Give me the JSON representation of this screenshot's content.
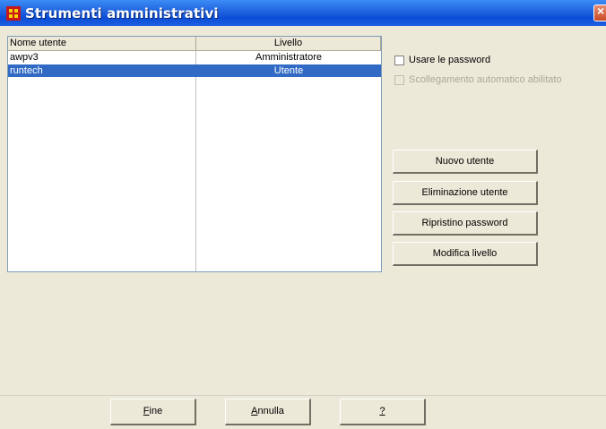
{
  "window": {
    "title": "Strumenti amministrativi",
    "icon": "app-flag-icon",
    "close_symbol": "×"
  },
  "users_table": {
    "columns": [
      "Nome utente",
      "Livello"
    ],
    "rows": [
      {
        "name": "awpv3",
        "level": "Amministratore",
        "selected": false
      },
      {
        "name": "runtech",
        "level": "Utente",
        "selected": true
      }
    ]
  },
  "options": {
    "use_passwords": {
      "label": "Usare le password",
      "checked": false,
      "enabled": true
    },
    "auto_logout": {
      "label": "Scollegamento automatico abilitato",
      "checked": false,
      "enabled": false
    }
  },
  "actions": {
    "new_user": "Nuovo utente",
    "delete_user": "Eliminazione utente",
    "reset_password": "Ripristino password",
    "change_level": "Modifica livello"
  },
  "footer": {
    "ok_first": "F",
    "ok_rest": "ine",
    "cancel_first": "A",
    "cancel_rest": "nnulla",
    "help": "?"
  },
  "colors": {
    "titlebar": "#0B4DD7",
    "selection": "#316AC5",
    "window_bg": "#ECE9D8"
  }
}
